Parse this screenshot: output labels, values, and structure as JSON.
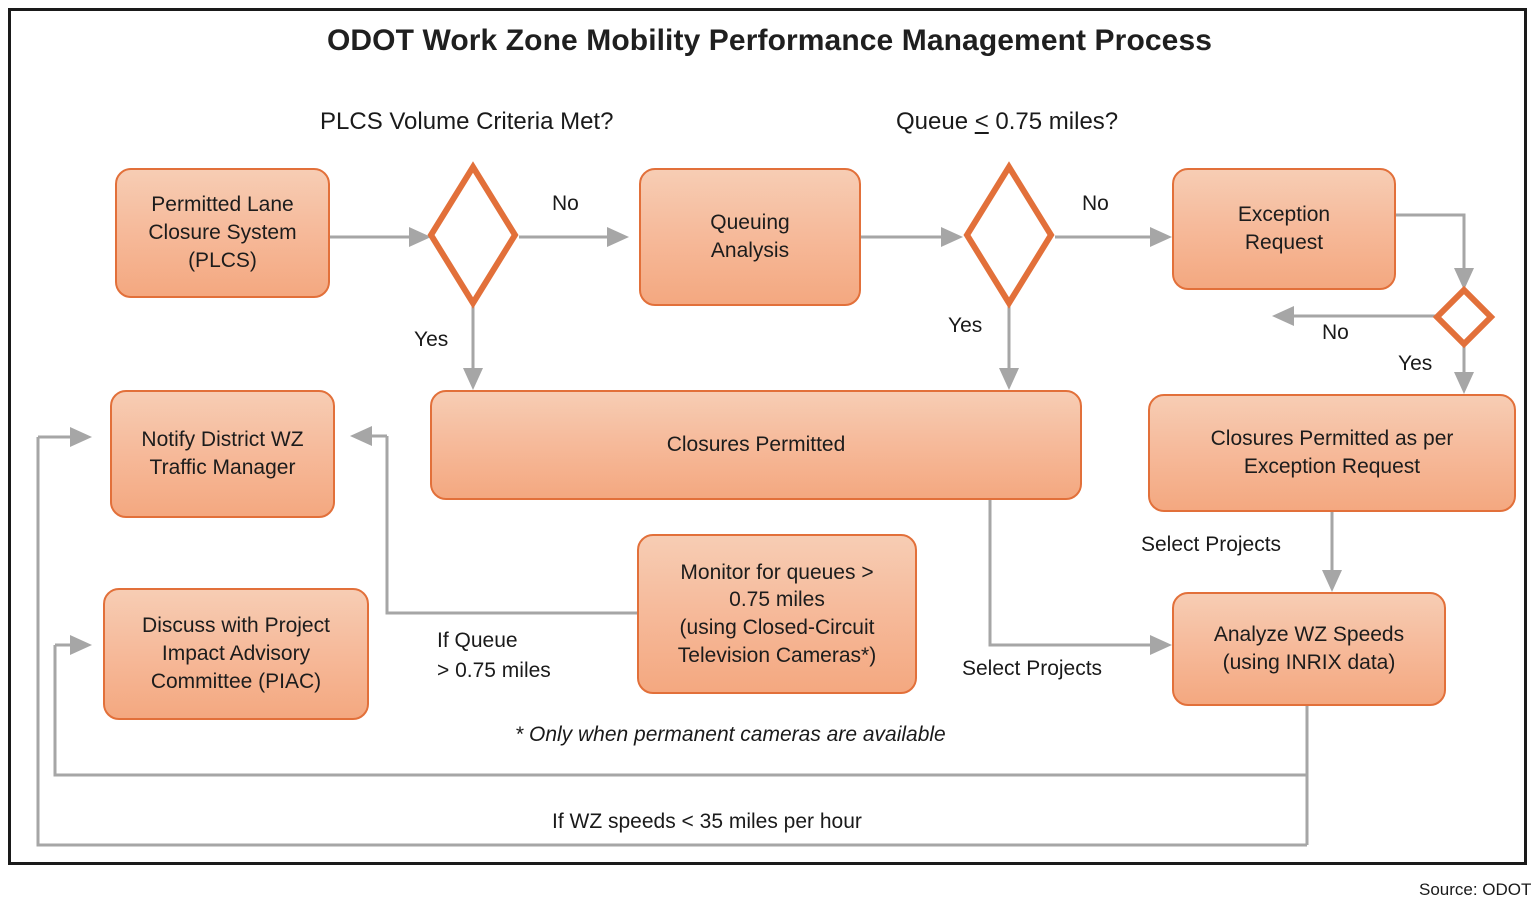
{
  "title": "ODOT Work Zone Mobility Performance Management Process",
  "source": "Source: ODOT",
  "colors": {
    "node_border": "#e2703a",
    "node_fill_top": "#f7cdb4",
    "node_fill_bottom": "#f4a880",
    "diamond_stroke": "#e2703a",
    "connector": "#a6a6a6",
    "frame": "#1a1a1a",
    "text": "#1a1a1a"
  },
  "headers": {
    "decision1": "PLCS Volume Criteria Met?",
    "decision2_pre": "Queue ",
    "decision2_op": "<",
    "decision2_post": " 0.75 miles?"
  },
  "nodes": {
    "plcs": "Permitted Lane\nClosure System\n(PLCS)",
    "queuing": "Queuing\nAnalysis",
    "exception": "Exception\nRequest",
    "notify": "Notify District WZ\nTraffic Manager",
    "closures_permitted": "Closures Permitted",
    "closures_exception": "Closures Permitted as per\nException Request",
    "piac": "Discuss with Project\nImpact Advisory\nCommittee (PIAC)",
    "monitor": "Monitor for queues >\n0.75 miles\n(using Closed-Circuit\nTelevision Cameras*)",
    "analyze": "Analyze WZ Speeds\n(using INRIX data)"
  },
  "edge_labels": {
    "no1": "No",
    "yes1": "Yes",
    "no2": "No",
    "yes2": "Yes",
    "no3": "No",
    "yes3": "Yes",
    "select_projects_right": "Select Projects",
    "select_projects_mid": "Select Projects",
    "if_queue": "If Queue\n> 0.75 miles",
    "if_speeds": "If WZ speeds < 35 miles per hour"
  },
  "footnote": "* Only when permanent cameras are available"
}
